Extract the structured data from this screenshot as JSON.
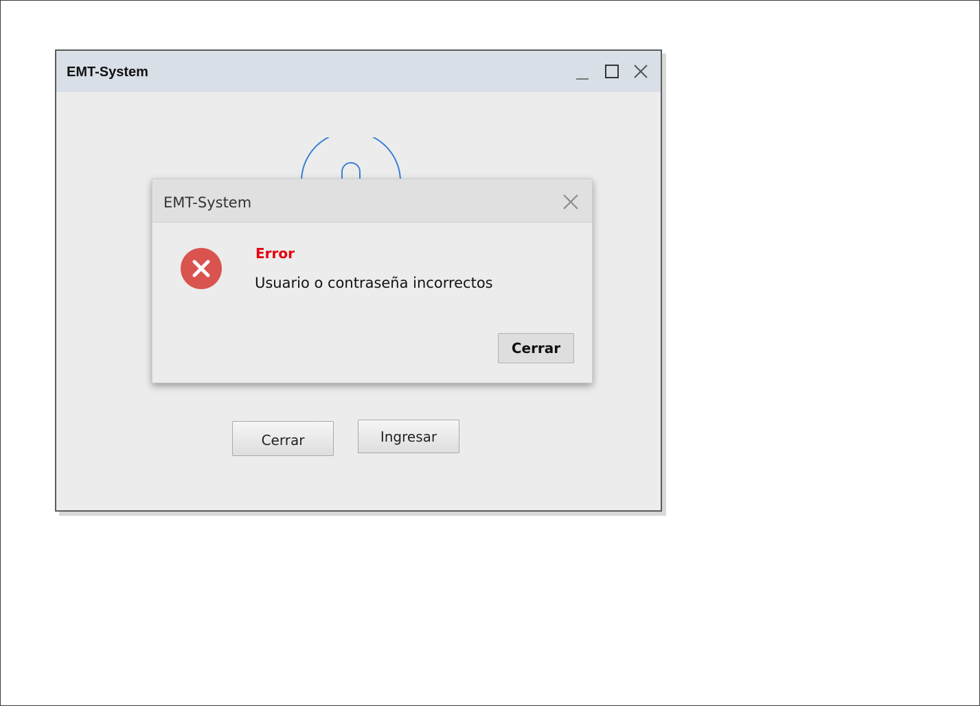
{
  "main_window": {
    "title": "EMT-System",
    "controls": {
      "minimize_icon": "minimize-icon",
      "maximize_icon": "maximize-icon",
      "close_icon": "close-icon"
    },
    "logo_icon": "lock-icon",
    "buttons": {
      "close_label": "Cerrar",
      "login_label": "Ingresar"
    },
    "colors": {
      "titlebar": "#d8dfe6",
      "logo_stroke": "#3a7fd5"
    }
  },
  "error_dialog": {
    "title": "EMT-System",
    "close_icon": "close-icon",
    "status_icon": "error-icon",
    "heading": "Error",
    "message": "Usuario o contraseña incorrectos",
    "button_label": "Cerrar",
    "colors": {
      "heading": "#e4000f",
      "error_icon": "#d9534f"
    }
  }
}
